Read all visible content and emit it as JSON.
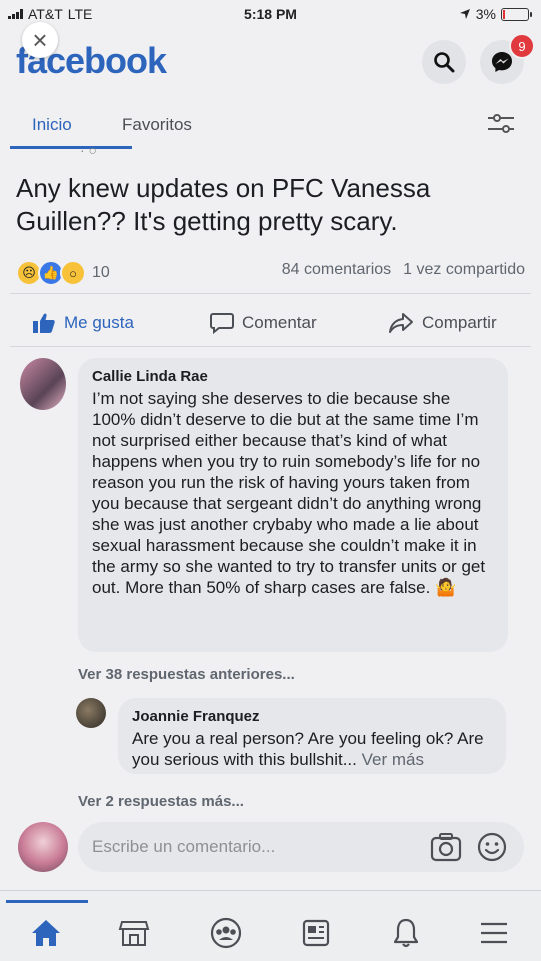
{
  "status_bar": {
    "carrier": "AT&T",
    "network": "LTE",
    "time": "5:18 PM",
    "battery": "3%"
  },
  "header": {
    "logo": "facebook",
    "messenger_badge": "9"
  },
  "tabs": [
    {
      "label": "Inicio",
      "active": true
    },
    {
      "label": "Favoritos",
      "active": false
    }
  ],
  "post": {
    "text": "Any knew updates on PFC Vanessa Guillen?? It's getting pretty scary.",
    "reaction_count": "10",
    "comments_count": "84 comentarios",
    "shares_count": "1 vez compartido"
  },
  "actions": {
    "like": "Me gusta",
    "comment": "Comentar",
    "share": "Compartir"
  },
  "comments": [
    {
      "author": "Callie Linda Rae",
      "text": "I’m not saying she deserves to die because she 100% didn’t deserve to die but at the same time I’m not surprised either because that’s kind of what happens when you try to ruin somebody’s life for no reason you run the risk of having yours taken from you because that sergeant didn’t do anything wrong she was just another crybaby who made a lie about sexual harassment because she couldn’t make it in the army so she wanted to try to transfer units or get out. More than 50% of sharp cases are false."
    }
  ],
  "previous_replies": "Ver 38 respuestas anteriores...",
  "reply": {
    "author": "Joannie Franquez",
    "text": "Are you a real person? Are you feeling ok? Are you serious with this bullshit...",
    "see_more": "Ver más"
  },
  "more_replies": "Ver 2 respuestas más...",
  "compose_placeholder": "Escribe un comentario...",
  "colors": {
    "brand": "#2d64bc",
    "badge": "#e0393e"
  },
  "bottom_nav": [
    "home-icon",
    "marketplace-icon",
    "groups-icon",
    "news-icon",
    "bell-icon",
    "menu-icon"
  ]
}
